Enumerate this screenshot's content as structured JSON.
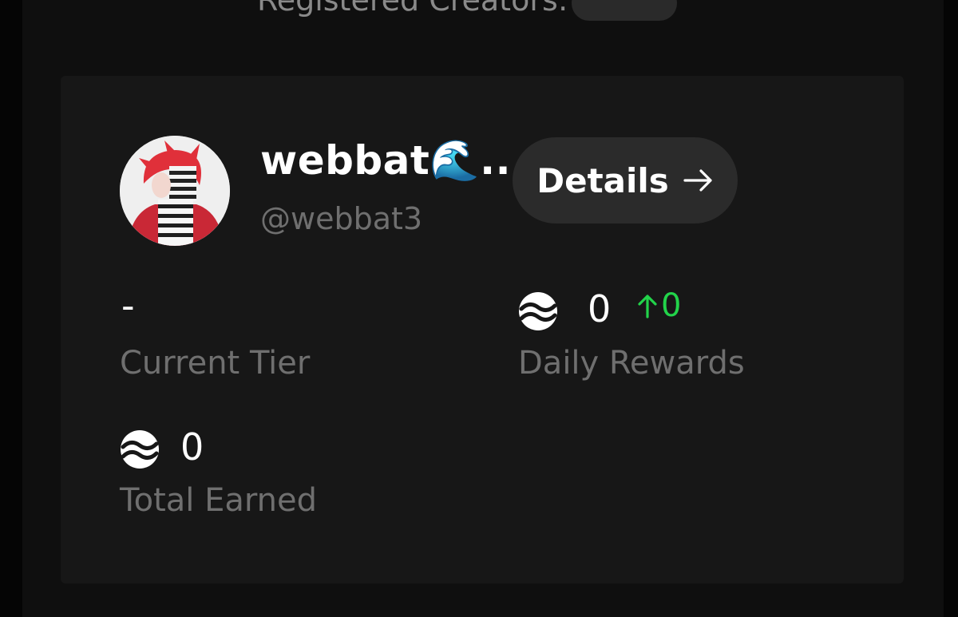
{
  "header": {
    "registered_label": "Registered Creators:"
  },
  "profile": {
    "name": "webbat🌊...",
    "handle": "@webbat3",
    "avatar": "avatar-image"
  },
  "details_button": {
    "label": "Details",
    "icon": "arrow-right-icon"
  },
  "stats": {
    "current_tier": {
      "value": "-",
      "label": "Current Tier"
    },
    "daily_rewards": {
      "icon": "token-icon",
      "value": "0",
      "change": "0",
      "change_icon": "arrow-up-icon",
      "label": "Daily Rewards"
    },
    "total_earned": {
      "icon": "token-icon",
      "value": "0",
      "label": "Total Earned"
    }
  },
  "colors": {
    "background": "#050505",
    "panel": "#0f0f0f",
    "card": "#171717",
    "button": "#2b2b2b",
    "positive": "#22d34a",
    "muted_text": "#6f6f6f"
  }
}
